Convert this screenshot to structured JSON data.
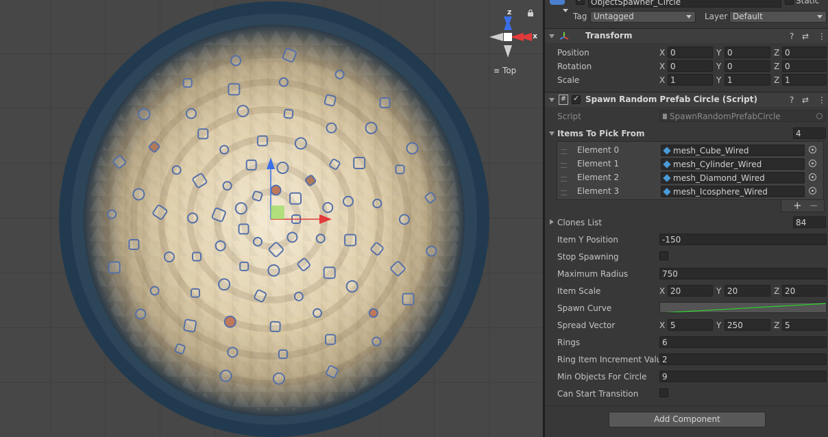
{
  "scene": {
    "view_label": "Top",
    "axis_labels": {
      "z": "z",
      "x": "x"
    },
    "colors": {
      "ground_light": "#efe3c8",
      "ground_mid": "#c9b693",
      "rim": "#1f3446",
      "outline": "#5570a8"
    }
  },
  "header": {
    "object_name": "ObjectSpawner_Circle",
    "static_label": "Static",
    "tag_label": "Tag",
    "tag_value": "Untagged",
    "layer_label": "Layer",
    "layer_value": "Default"
  },
  "transform": {
    "title": "Transform",
    "rows": [
      {
        "label": "Position",
        "x": "0",
        "y": "0",
        "z": "0"
      },
      {
        "label": "Rotation",
        "x": "0",
        "y": "0",
        "z": "0"
      },
      {
        "label": "Scale",
        "x": "1",
        "y": "1",
        "z": "1"
      }
    ]
  },
  "script_component": {
    "title": "Spawn Random Prefab Circle (Script)",
    "script_label": "Script",
    "script_value": "SpawnRandomPrefabCircle",
    "items_label": "Items To Pick From",
    "items_count": "4",
    "items": [
      {
        "label": "Element 0",
        "value": "mesh_Cube_Wired"
      },
      {
        "label": "Element 1",
        "value": "mesh_Cylinder_Wired"
      },
      {
        "label": "Element 2",
        "value": "mesh_Diamond_Wired"
      },
      {
        "label": "Element 3",
        "value": "mesh_Icosphere_Wired"
      }
    ],
    "clones_label": "Clones List",
    "clones_count": "84",
    "item_y_label": "Item Y Position",
    "item_y_value": "-150",
    "stop_spawning_label": "Stop Spawning",
    "max_radius_label": "Maximum Radius",
    "max_radius_value": "750",
    "item_scale_label": "Item Scale",
    "item_scale": {
      "x": "20",
      "y": "20",
      "z": "20"
    },
    "spawn_curve_label": "Spawn Curve",
    "spread_label": "Spread Vector",
    "spread": {
      "x": "5",
      "y": "250",
      "z": "5"
    },
    "rings_label": "Rings",
    "rings_value": "6",
    "ring_inc_label": "Ring Item Increment Value",
    "ring_inc_value": "2",
    "min_objects_label": "Min Objects For Circle",
    "min_objects_value": "9",
    "can_start_label": "Can Start Transition"
  },
  "add_component_label": "Add Component"
}
